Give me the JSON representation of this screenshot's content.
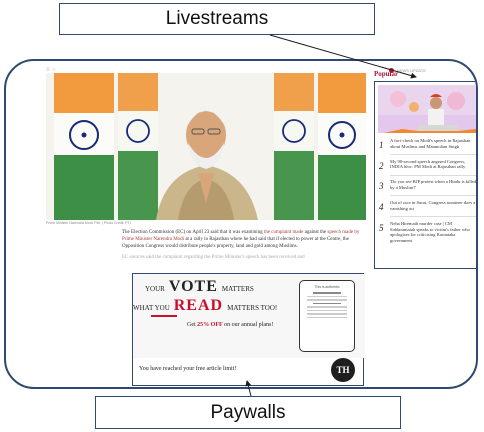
{
  "callouts": {
    "top": "Livestreams",
    "bottom": "Paywalls"
  },
  "header": {
    "left_icon": "menu-icon",
    "right_text": "NEWS UPDATE"
  },
  "hero": {
    "caption": "Prime Minister Narendra Modi. File. | Photo Credit: PTI"
  },
  "article": {
    "p1_start": "The Election Commission (EC) on April 23 said that it was examining ",
    "p1_link1": "the complaint made",
    "p1_mid1": " against the ",
    "p1_link2": "speech made by Prime Minister Narendra Modi",
    "p1_end": " at a rally in Rajasthan where he had said that if elected to power at the Centre, the Opposition Congress would distribute people's property, land and gold among Muslims.",
    "p2": "EC sources said the complaint regarding the Prime Minister's speech has been received and"
  },
  "paywall": {
    "line1_small": "YOUR",
    "line1_big": "VOTE",
    "line1_tail": "MATTERS",
    "line2_small": "WHAT YOU",
    "line2_big": "READ",
    "line2_tail": "MATTERS TOO!",
    "offer_pre": "Get ",
    "offer_pct": "25% OFF",
    "offer_post": " on our annual plans!",
    "phone_title": "This is authentic",
    "limit_text": "You have reached your free article limit!",
    "logo": "TH"
  },
  "sidebar": {
    "heading": "Popular",
    "items": [
      {
        "num": "1",
        "text": "A fact-check on Modi's speech in Rajasthan about Muslims and Manmohan Singh"
      },
      {
        "num": "2",
        "text": "My 90-second speech angered Congress, INDIA bloc: PM Modi at Rajasthan rally"
      },
      {
        "num": "3",
        "text": "'Do you see BJP protest when a Hindu is killed by a Muslim?'"
      },
      {
        "num": "4",
        "text": "Out of race in Surat, Congress nominee does a vanishing act"
      },
      {
        "num": "5",
        "text": "Neha Hiremath murder case | CM Siddaramaiah speaks to victim's father who apologises for criticising Karnataka government"
      }
    ]
  },
  "colors": {
    "frame": "#2f4a6e",
    "accent_red": "#c8102e",
    "popular": "#a3163a"
  }
}
